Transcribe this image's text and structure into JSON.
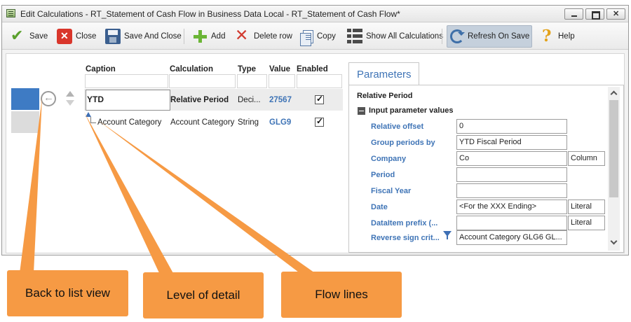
{
  "window": {
    "title": "Edit Calculations - RT_Statement of Cash Flow in Business Data Local - RT_Statement of Cash Flow*"
  },
  "toolbar": {
    "save": "Save",
    "close": "Close",
    "save_and_close": "Save And Close",
    "add": "Add",
    "delete_row": "Delete row",
    "copy": "Copy",
    "show_all": "Show All Calculations",
    "refresh_on_save": "Refresh On Save",
    "help": "Help"
  },
  "grid": {
    "columns": [
      "Caption",
      "Calculation",
      "Type",
      "Value",
      "Enabled"
    ],
    "rows": [
      {
        "caption": "YTD",
        "calculation": "Relative Period",
        "type": "Deci...",
        "value": "27567",
        "enabled": true
      },
      {
        "caption": "Account Category",
        "calculation": "Account Category",
        "type": "String",
        "value": "GLG9",
        "enabled": true
      }
    ]
  },
  "parameters": {
    "tab": "Parameters",
    "section": "Relative Period",
    "group": "Input parameter values",
    "rows": [
      {
        "label": "Relative offset",
        "value": "0",
        "extra": ""
      },
      {
        "label": "Group periods by",
        "value": "YTD Fiscal Period",
        "extra": ""
      },
      {
        "label": "Company",
        "value": "Co",
        "extra": "Column"
      },
      {
        "label": "Period",
        "value": "",
        "extra": ""
      },
      {
        "label": "Fiscal Year",
        "value": "",
        "extra": ""
      },
      {
        "label": "Date",
        "value": "<For the XXX Ending>",
        "extra": "Literal"
      },
      {
        "label": "DataItem prefix (...",
        "value": "",
        "extra": "Literal"
      },
      {
        "label": "Reverse sign crit...",
        "value": "Account Category GLG6 GL...",
        "extra": ""
      }
    ]
  },
  "callouts": {
    "back": "Back to list view",
    "level": "Level of detail",
    "flow": "Flow lines"
  },
  "colors": {
    "accent_blue": "#3e7bc4",
    "link_blue": "#3f74b6",
    "callout_orange": "#f69a44"
  }
}
